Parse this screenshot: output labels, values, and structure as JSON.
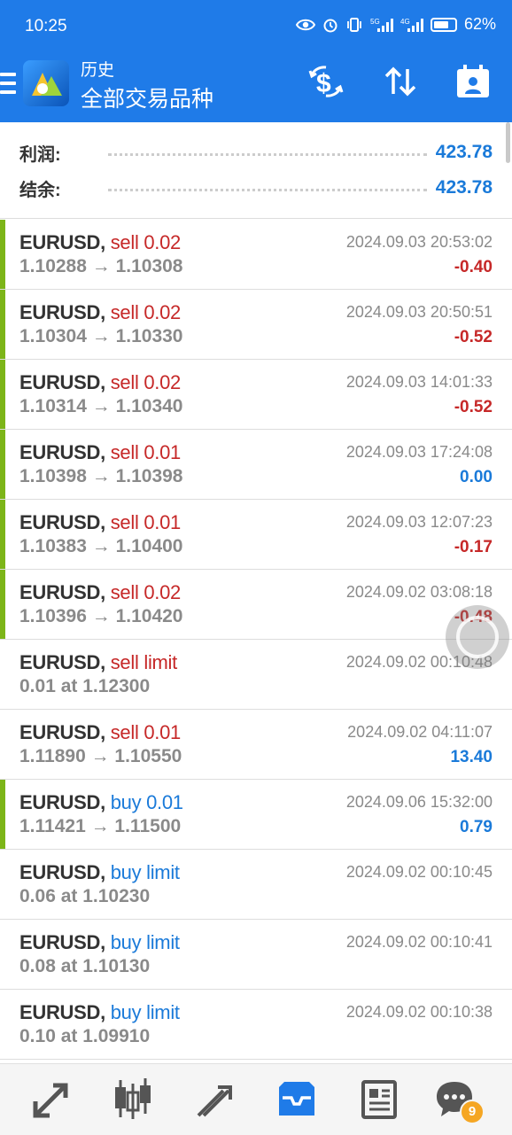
{
  "status_bar": {
    "time": "10:25",
    "battery": "62%"
  },
  "header": {
    "subtitle": "历史",
    "title": "全部交易品种"
  },
  "summary": [
    {
      "label": "利润:",
      "value": "423.78"
    },
    {
      "label": "结余:",
      "value": "423.78"
    }
  ],
  "trades": [
    {
      "symbol": "EURUSD,",
      "action": "sell 0.02",
      "side": "sell",
      "prices": "1.10288 → 1.10308",
      "time": "2024.09.03 20:53:02",
      "profit": "-0.40",
      "closed": true
    },
    {
      "symbol": "EURUSD,",
      "action": "sell 0.02",
      "side": "sell",
      "prices": "1.10304 → 1.10330",
      "time": "2024.09.03 20:50:51",
      "profit": "-0.52",
      "closed": true
    },
    {
      "symbol": "EURUSD,",
      "action": "sell 0.02",
      "side": "sell",
      "prices": "1.10314 → 1.10340",
      "time": "2024.09.03 14:01:33",
      "profit": "-0.52",
      "closed": true
    },
    {
      "symbol": "EURUSD,",
      "action": "sell 0.01",
      "side": "sell",
      "prices": "1.10398 → 1.10398",
      "time": "2024.09.03 17:24:08",
      "profit": "0.00",
      "closed": true
    },
    {
      "symbol": "EURUSD,",
      "action": "sell 0.01",
      "side": "sell",
      "prices": "1.10383 → 1.10400",
      "time": "2024.09.03 12:07:23",
      "profit": "-0.17",
      "closed": true
    },
    {
      "symbol": "EURUSD,",
      "action": "sell 0.02",
      "side": "sell",
      "prices": "1.10396 → 1.10420",
      "time": "2024.09.02 03:08:18",
      "profit": "-0.48",
      "closed": true
    },
    {
      "symbol": "EURUSD,",
      "action": "sell limit",
      "side": "sell",
      "prices": "0.01 at 1.12300",
      "time": "2024.09.02 00:10:48",
      "profit": "",
      "closed": false
    },
    {
      "symbol": "EURUSD,",
      "action": "sell 0.01",
      "side": "sell",
      "prices": "1.11890 → 1.10550",
      "time": "2024.09.02 04:11:07",
      "profit": "13.40",
      "closed": false
    },
    {
      "symbol": "EURUSD,",
      "action": "buy 0.01",
      "side": "buy",
      "prices": "1.11421 → 1.11500",
      "time": "2024.09.06 15:32:00",
      "profit": "0.79",
      "closed": true
    },
    {
      "symbol": "EURUSD,",
      "action": "buy limit",
      "side": "buy",
      "prices": "0.06 at 1.10230",
      "time": "2024.09.02 00:10:45",
      "profit": "",
      "closed": false
    },
    {
      "symbol": "EURUSD,",
      "action": "buy limit",
      "side": "buy",
      "prices": "0.08 at 1.10130",
      "time": "2024.09.02 00:10:41",
      "profit": "",
      "closed": false
    },
    {
      "symbol": "EURUSD,",
      "action": "buy limit",
      "side": "buy",
      "prices": "0.10 at 1.09910",
      "time": "2024.09.02 00:10:38",
      "profit": "",
      "closed": false
    }
  ],
  "nav": {
    "chat_badge": "9"
  },
  "colors": {
    "primary": "#1f7be8",
    "sell": "#c62828",
    "buy": "#1a7ad9",
    "closed_marker": "#7cb518"
  }
}
